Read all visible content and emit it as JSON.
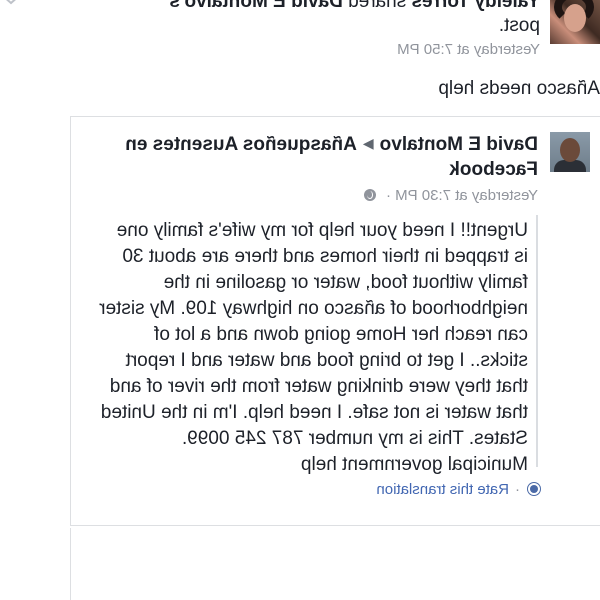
{
  "outer_post": {
    "author": "Yaleidy Torres",
    "verb": "shared",
    "shared_from": "David E Montalvo's",
    "object": "post.",
    "timestamp": "Yesterday at 7:50 PM",
    "message": "Añasco needs help"
  },
  "shared_post": {
    "author": "David E Montalvo",
    "group": "Añasqueños Ausentes en Facebook",
    "timestamp": "Yesterday at 7:30 PM",
    "privacy_icon": "globe-icon",
    "body": "Urgent!! I need your help for my wife's family one is trapped in their homes and there are about 30 family without food, water or gasoline in the neighborhood of añasco on highway 109. My sister can reach her Home going down and a lot of sticks.. I get to bring food and water and I report that they were drinking water from the river of and that water is not safe. I need help. I'm in the United States. This is my number 787 245 0099. Municipal government help",
    "translate_separator": "·",
    "translate_link": "Rate this translation",
    "translate_icon": "gear-icon"
  }
}
